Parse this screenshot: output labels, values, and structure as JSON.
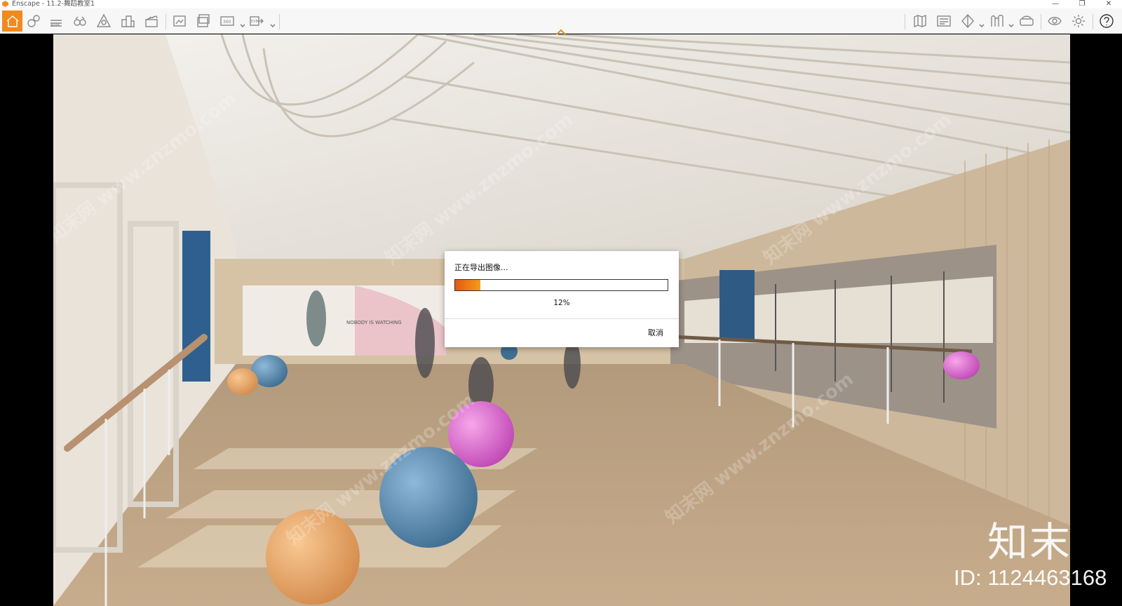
{
  "window": {
    "title": "Enscape - 11.2-舞蹈教室1",
    "controls": [
      "—",
      "❐",
      "✕"
    ]
  },
  "toolbar": {
    "left_tools": [
      {
        "name": "home-icon"
      },
      {
        "name": "asset-library-icon"
      },
      {
        "name": "bim-icon",
        "label": "BIM"
      },
      {
        "name": "views-icon"
      },
      {
        "name": "atmosphere-icon"
      },
      {
        "name": "buildings-icon"
      },
      {
        "name": "video-editor-icon"
      },
      {
        "name": "screenshot-icon"
      },
      {
        "name": "batch-render-icon"
      },
      {
        "name": "panorama-icon",
        "label": "360°"
      },
      {
        "name": "export-exe-icon",
        "label": "EXE"
      }
    ],
    "right_tools": [
      {
        "name": "map-icon"
      },
      {
        "name": "minimap-icon"
      },
      {
        "name": "section-icon"
      },
      {
        "name": "material-icon"
      },
      {
        "name": "vr-headset-icon"
      },
      {
        "name": "visibility-eye-icon"
      },
      {
        "name": "settings-gear-icon"
      },
      {
        "name": "help-icon"
      }
    ],
    "accent": "#f08a1c"
  },
  "scene": {
    "mural_text": "NOBODY IS WATCHING"
  },
  "dialog": {
    "message": "正在导出图像...",
    "progress_label": "12%",
    "progress": 0.12,
    "cancel_label": "取消"
  },
  "watermark": {
    "text": "知末网 www.znzmo.com",
    "brand": "知末",
    "id": "ID: 1124463168"
  }
}
